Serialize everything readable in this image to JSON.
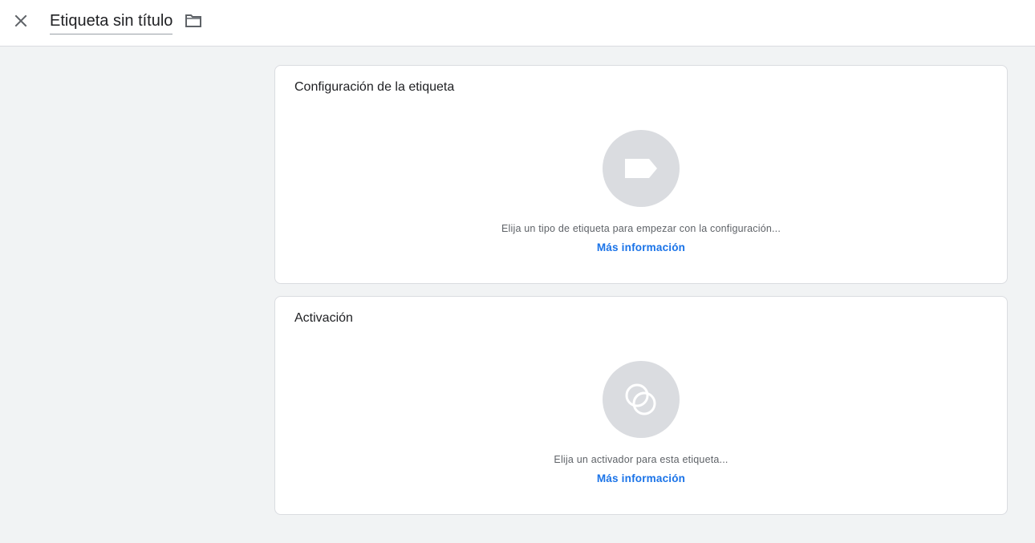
{
  "header": {
    "title": "Etiqueta sin título",
    "close_icon": "close-icon",
    "folder_icon": "folder-icon"
  },
  "tag_config": {
    "title": "Configuración de la etiqueta",
    "icon": "tag-icon",
    "hint": "Elija un tipo de etiqueta para empezar con la configuración...",
    "link": "Más información"
  },
  "triggering": {
    "title": "Activación",
    "icon": "trigger-icon",
    "hint": "Elija un activador para esta etiqueta...",
    "link": "Más información"
  },
  "colors": {
    "background": "#f1f3f4",
    "card": "#ffffff",
    "border": "#dadce0",
    "icon_circle": "#dadce0",
    "link": "#1a73e8"
  }
}
